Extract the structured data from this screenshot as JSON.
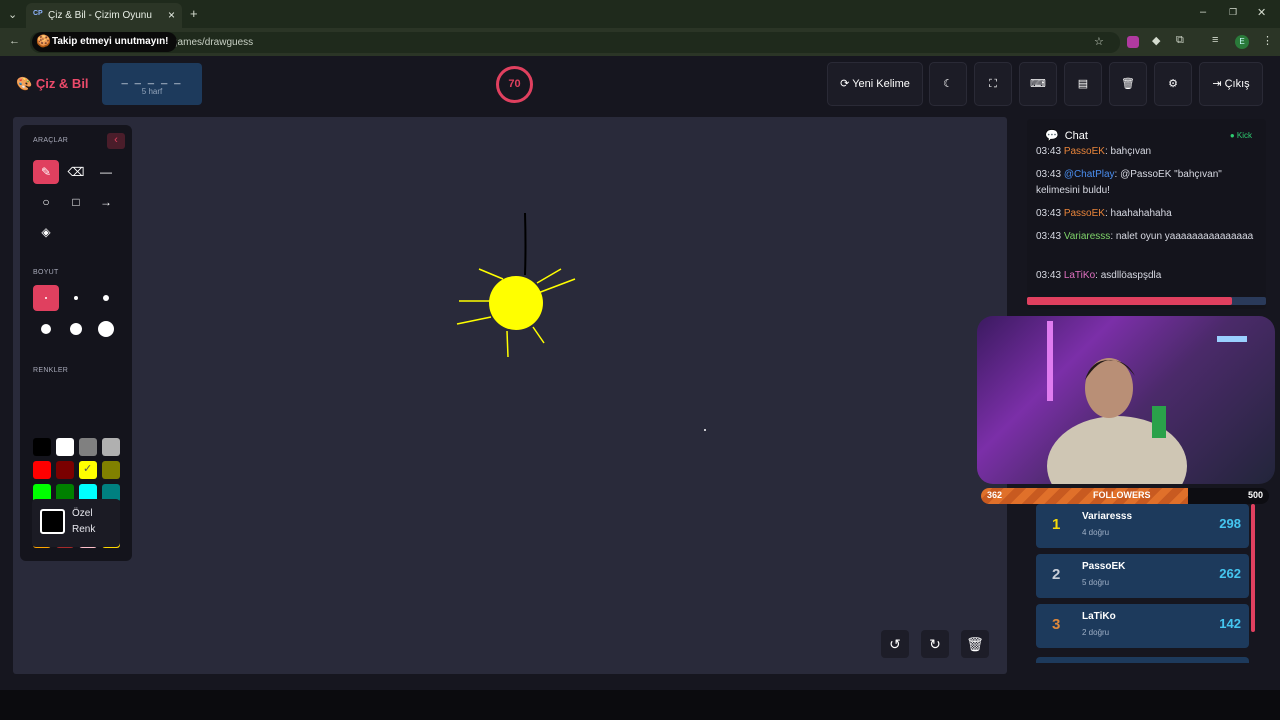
{
  "browser": {
    "tab_title": "Çiz & Bil - Çizim Oyunu",
    "tab_favicon": "CP",
    "url_fragment": "games/drawguess",
    "toast": "Takip etmeyi unutmayın!",
    "profile_initial": "E"
  },
  "header": {
    "logo": "Çiz & Bil",
    "word_blanks": "_ _ _ _ _",
    "word_length": "5 harf",
    "timer": "70",
    "new_word": "Yeni Kelime",
    "exit": "Çıkış"
  },
  "tools": {
    "title": "ARAÇLAR",
    "size_title": "BOYUT",
    "colors_title": "RENKLER",
    "custom_color": "Özel Renk",
    "swatches": [
      "#000000",
      "#ffffff",
      "#808080",
      "#b0b0b0",
      "#ff0000",
      "#7a0000",
      "#ffff00",
      "#808000",
      "#00ff00",
      "#008000",
      "#00ffff",
      "#008080",
      "#0000ff",
      "#000080",
      "#ff00ff",
      "#800080",
      "#ffa500",
      "#a52a2a",
      "#ffc0cb",
      "#ffd700"
    ],
    "selected_swatch": "#ffff00"
  },
  "chat": {
    "title": "Chat",
    "source": "Kick",
    "messages": [
      {
        "time": "03:43",
        "user": "PassoEK",
        "color": "#e8843a",
        "text": ": bahçıvan"
      },
      {
        "time": "03:43",
        "user": "@ChatPlay",
        "color": "#4a8ef0",
        "text": ": @PassoEK \"bahçıvan\" kelimesini buldu!"
      },
      {
        "time": "03:43",
        "user": "PassoEK",
        "color": "#e8843a",
        "text": ": haahahahaha"
      },
      {
        "time": "03:43",
        "user": "Variaresss",
        "color": "#7fd46a",
        "text": ": nalet oyun yaaaaaaaaaaaaaaa"
      },
      {
        "time": "03:43",
        "user": "LaTiKo",
        "color": "#e070c0",
        "text": ": asdllöaspşdla"
      }
    ]
  },
  "followers": {
    "label": "FOLLOWERS",
    "current": "362",
    "goal": "500",
    "progress_fraction": 0.72
  },
  "leaderboard": [
    {
      "rank": "1",
      "name": "Variaresss",
      "correct": "4 doğru",
      "score": "298",
      "color": "#f5d90a"
    },
    {
      "rank": "2",
      "name": "PassoEK",
      "correct": "5 doğru",
      "score": "262",
      "color": "#c9ced8"
    },
    {
      "rank": "3",
      "name": "LaTiKo",
      "correct": "2 doğru",
      "score": "142",
      "color": "#e0883a"
    }
  ]
}
